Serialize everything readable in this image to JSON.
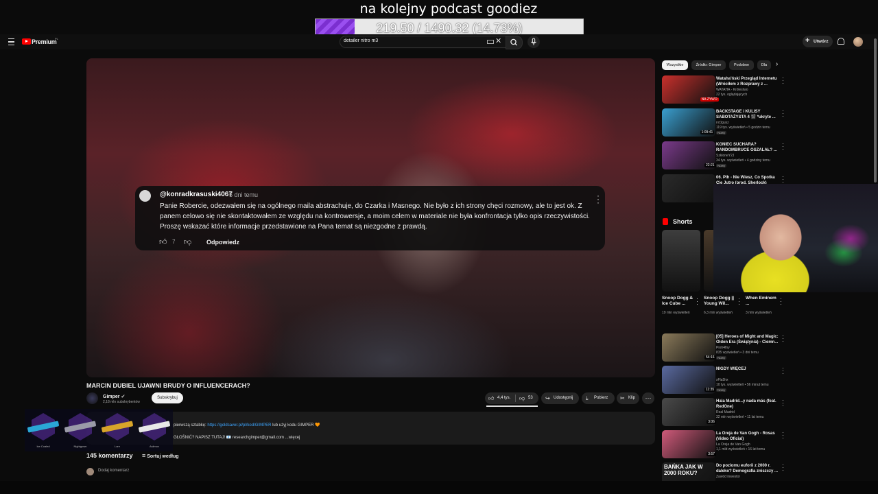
{
  "stream_overlay": {
    "title": "na kolejny podcast goodiez",
    "progress_text": "219.50 / 1490.32 (14.73%)",
    "progress_fraction": 0.1473,
    "accent_color": "#8a3fe6"
  },
  "header": {
    "brand": "Premium",
    "brand_sup": "PL",
    "search_value": "detailer nitro m3",
    "create_label": "Utwórz",
    "icons": [
      "menu-icon",
      "youtube-logo-icon",
      "keyboard-icon",
      "clear-icon",
      "search-icon",
      "mic-icon",
      "bell-icon",
      "avatar"
    ]
  },
  "comment_card": {
    "author": "@konradkrasuski4067",
    "time": "5 dni temu",
    "text": "Panie Robercie, odezwałem się na ogólnego maila abstrachuje, do Czarka i Masnego. Nie było z ich strony chęci rozmowy, ale to jest ok. Z panem celowo się nie skontaktowałem ze względu na kontrowersje, a moim celem w materiale nie była konfrontacja tylko opis rzeczywistości. Proszę wskazać które informacje przedstawione na Pana temat są niezgodne z prawdą.",
    "likes": "7",
    "reply_label": "Odpowiedz"
  },
  "video": {
    "title": "MARCIN DUBIEL UJAWNI BRUDY O INFLUENCERACH?",
    "channel": "Gimper",
    "subscribers": "2,18 mln subskrybentów",
    "subscribe_label": "Subskrybuj",
    "likes": "4,4 tys.",
    "dislikes": "53",
    "share_label": "Udostępnij",
    "download_label": "Pobierz",
    "clip_label": "Klip",
    "desc_line1_prefix": "pierwszą sztabkę: ",
    "desc_link": "https://goldsaver.pl/pl/kod/GIMPER",
    "desc_line1_suffix": " lub użyj kodu GIMPER 🧡",
    "desc_line2": "GŁOŚNIĆ? NAPISZ TUTAJ! 📧 researchgimper@gmail.com",
    "more_label": "...więcej",
    "comments_count": "145 komentarzy",
    "sort_label": "Sortuj według",
    "add_comment": "Dodaj komentarz"
  },
  "skins": [
    {
      "label": "Ice Coaled",
      "color": "#2aa7d6"
    },
    {
      "label": "Nightgown",
      "color": "#9a9aa8"
    },
    {
      "label": "Lore",
      "color": "#d8a42a"
    },
    {
      "label": "Asiimov",
      "color": "#e8e8e8"
    }
  ],
  "sidebar": {
    "chips": [
      "Wszystkie",
      "Źródło: Gimper",
      "Podobne",
      "Dla"
    ],
    "recs_top": [
      {
        "title": "Wataha'ński Przegląd Internetu (Wróciłem z Rozprawy z ...",
        "channel": "WATAHA - Królestwo",
        "meta": "22 tys. oglądających",
        "badge": "NA ŻYWO",
        "thumb": "#c9302c",
        "badge_kind": "live"
      },
      {
        "title": "BACKSTAGE i KULISY SABOTAŻYSTA 4 🎬 *ukryte ...",
        "channel": "nc0gusz",
        "meta": "119 tys. wyświetleń • 5 godzin temu",
        "badge": "1:09:41",
        "thumb": "#3a9fd0",
        "new": "Nowy"
      },
      {
        "title": "KONIEC SUCHARA? RANDOMBRUCE OSZALAŁ? ...",
        "channel": "SzkloneY2J",
        "meta": "34 tys. wyświetleń • 4 godziny temu",
        "badge": "22:21",
        "thumb": "#7a3a8a",
        "new": "Nowy"
      },
      {
        "title": "06. Plh - Nie Wiesz, Co Spotka Cię Jutro (prod. Sherlock)",
        "channel": "",
        "meta": "",
        "badge": "",
        "thumb": "#2a2a2a"
      }
    ],
    "shorts_label": "Shorts",
    "shorts": [
      {
        "title": "Snoop Dogg & Ice Cube ...",
        "meta": "19 mln wyświetleń",
        "thumb": "#3d3d3d"
      },
      {
        "title": "Snoop Dogg || Young Wil...",
        "meta": "6,3 mln wyświetleń",
        "thumb": "#4a3a2a"
      },
      {
        "title": "When Eminem ...",
        "meta": "3 mln wyświetleń",
        "thumb": "#2a2a3a"
      }
    ],
    "recs_bottom": [
      {
        "title": "[05] Heroes of Might and Magic: Olden Era (Świątynia) - Ciemn...",
        "channel": "Piotr4fny",
        "meta": "835 wyświetleń • 3 dni temu",
        "badge": "54:16",
        "thumb": "#8a7a5a",
        "new": "Nowy"
      },
      {
        "title": "NIGDY WIĘCEJ",
        "channel": "xFla5hx",
        "meta": "10 tys. wyświetleń • 56 minut temu",
        "badge": "11:35",
        "thumb": "#5a6aa0",
        "new": "Nowy"
      },
      {
        "title": "Hala Madrid...y nada más (feat. RedOne)",
        "channel": "Real Madrid",
        "meta": "32 mln wyświetleń • 11 lat temu",
        "badge": "3:06",
        "thumb": "#4a4a4a"
      },
      {
        "title": "La Oreja de Van Gogh - Rosas (Video Oficial)",
        "channel": "La Oreja de Van Gogh",
        "meta": "1,1 mld wyświetleń • 16 lat temu",
        "badge": "3:57",
        "thumb": "#d05a7a"
      },
      {
        "title": "Do poziomu euforii z 2000 r. daleko? Demografia zniszczy ...",
        "channel": "Zawód inwestor",
        "meta": "",
        "badge": "",
        "thumb": "#222222",
        "overlay": "BAŃKA JAK W 2000 ROKU?"
      }
    ]
  }
}
